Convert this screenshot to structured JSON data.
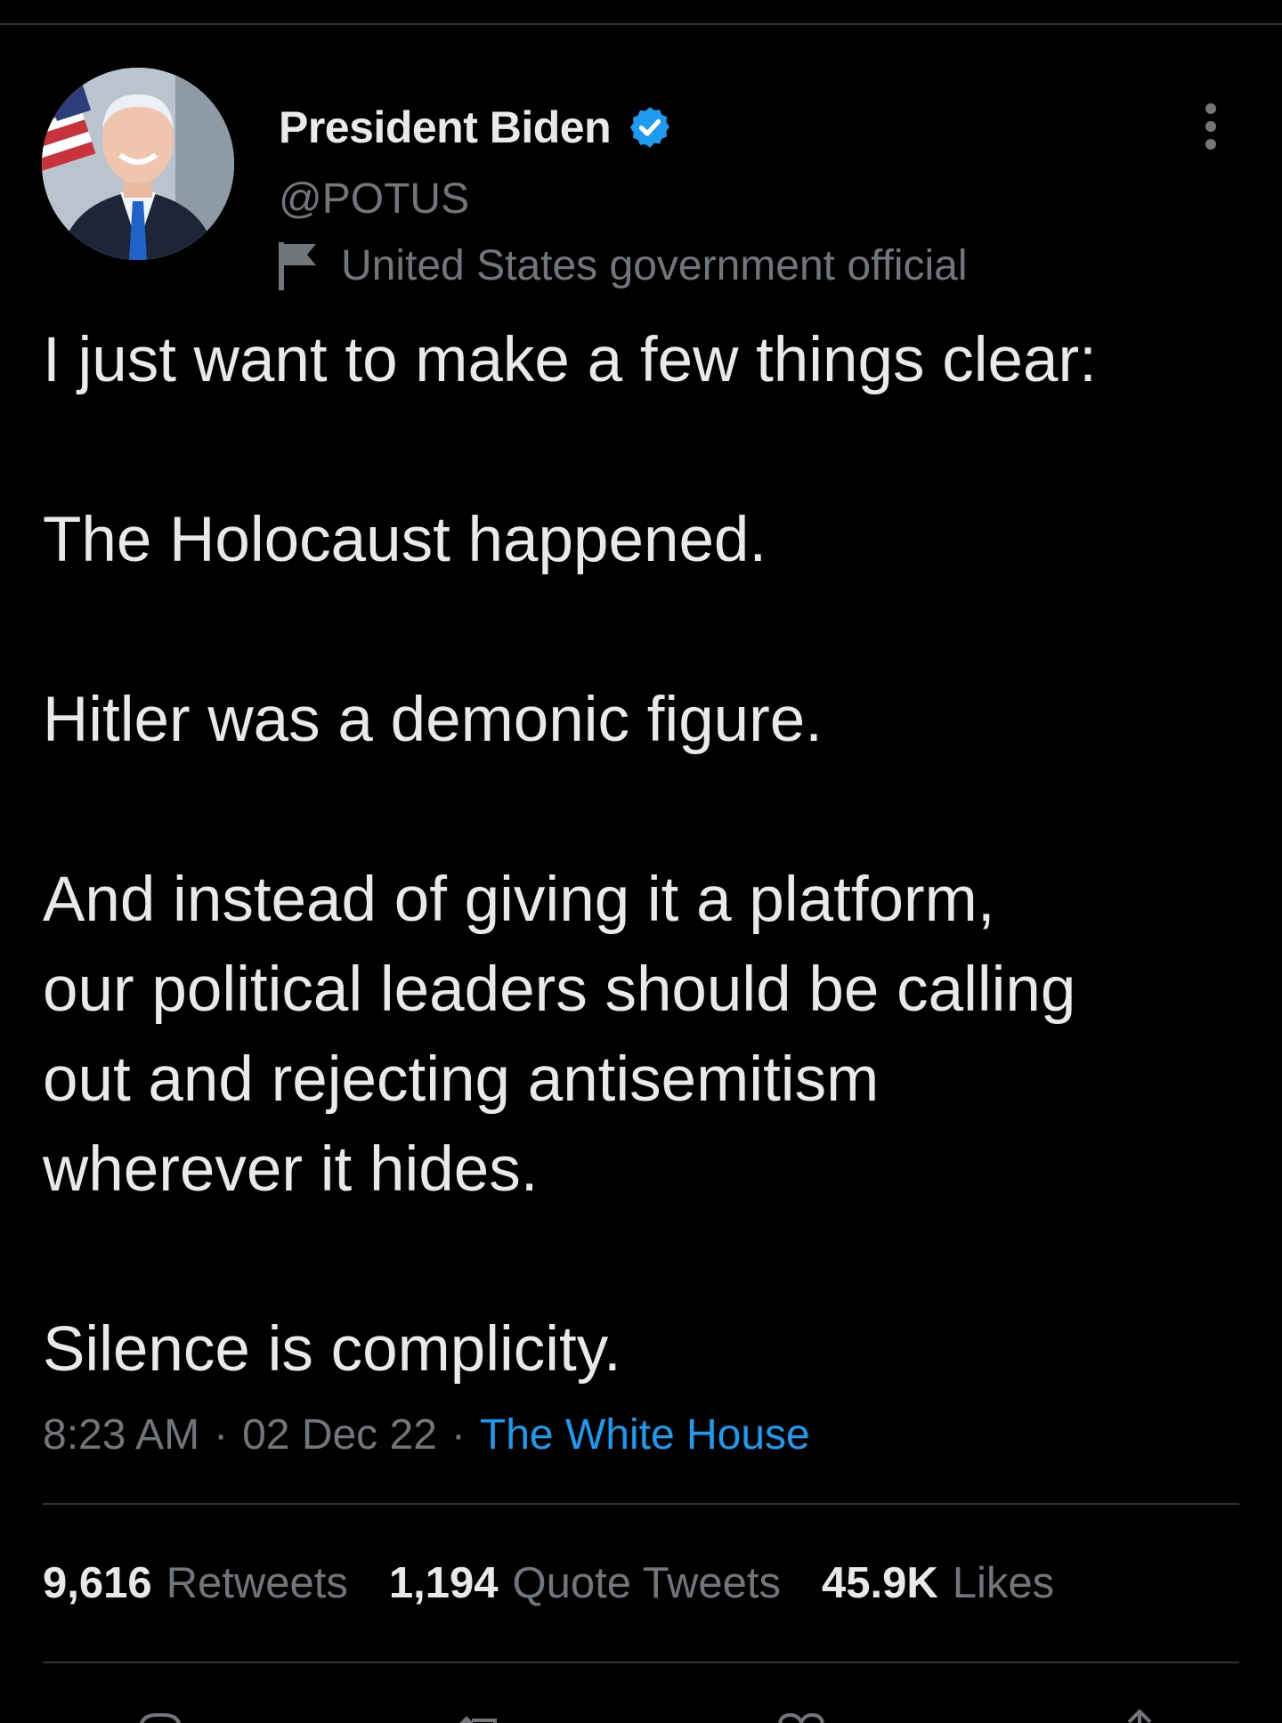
{
  "tweet": {
    "author": {
      "display_name": "President Biden",
      "handle": "@POTUS",
      "label": "United States government official",
      "verified_color": "#1d9bf0"
    },
    "text_lines": [
      "I just want to make a few things clear:",
      "The Holocaust happened.",
      "Hitler was a demonic figure.",
      "And instead of giving it a platform,",
      "our political leaders should be calling",
      "out and rejecting antisemitism",
      "wherever it hides.",
      "Silence is complicity."
    ],
    "time": "8:23 AM",
    "date": "02 Dec 22",
    "separator": "·",
    "source": "The White House"
  },
  "stats": {
    "retweets_count": "9,616",
    "retweets_label": "Retweets",
    "quote_count": "1,194",
    "quote_label": "Quote Tweets",
    "likes_count": "45.9K",
    "likes_label": "Likes"
  },
  "icons": {
    "more": "more-vertical-icon",
    "verified": "verified-badge-icon",
    "label": "flag-icon",
    "actions": [
      "reply-icon",
      "retweet-icon",
      "like-icon",
      "share-icon"
    ]
  },
  "colors": {
    "background": "#000000",
    "text": "#e7e9ea",
    "secondary": "#71767b",
    "accent": "#1d9bf0",
    "divider": "#2f3336"
  }
}
